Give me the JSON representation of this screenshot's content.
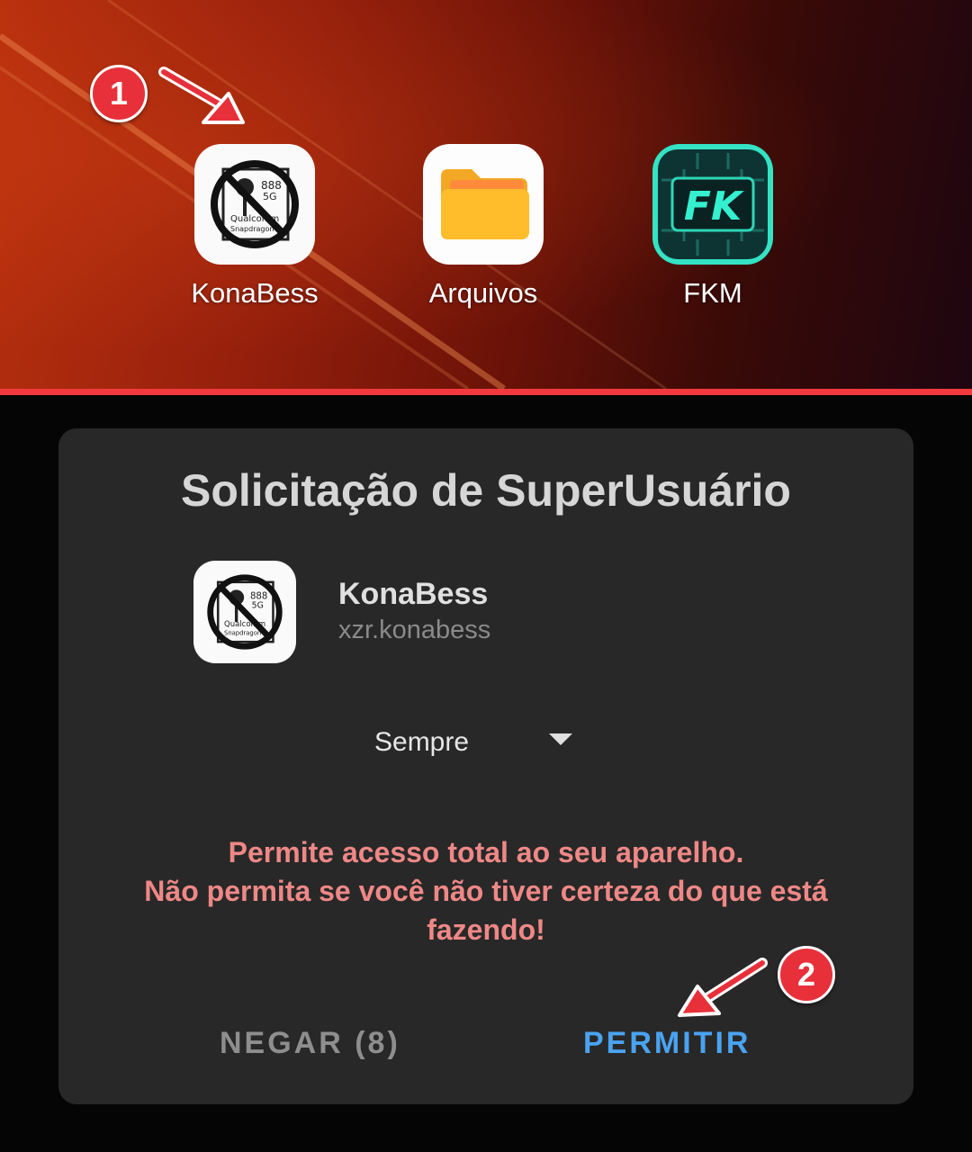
{
  "home": {
    "apps": [
      {
        "label": "KonaBess",
        "icon": "konabess-icon"
      },
      {
        "label": "Arquivos",
        "icon": "folder-icon"
      },
      {
        "label": "FKM",
        "icon": "fkm-icon",
        "icon_text": "FK"
      }
    ]
  },
  "annotations": {
    "step1": "1",
    "step2": "2"
  },
  "dialog": {
    "title": "Solicitação de SuperUsuário",
    "app_name": "KonaBess",
    "app_package": "xzr.konabess",
    "duration_selected": "Sempre",
    "warning_lines": [
      "Permite acesso total ao seu aparelho.",
      "Não permita se você não tiver certeza do que está",
      "fazendo!"
    ],
    "deny_label": "NEGAR (8)",
    "allow_label": "PERMITIR"
  },
  "colors": {
    "accent_allow": "#4aa3f0",
    "warning": "#ee8886",
    "badge": "#e8303a",
    "divider": "#f23a3e"
  }
}
